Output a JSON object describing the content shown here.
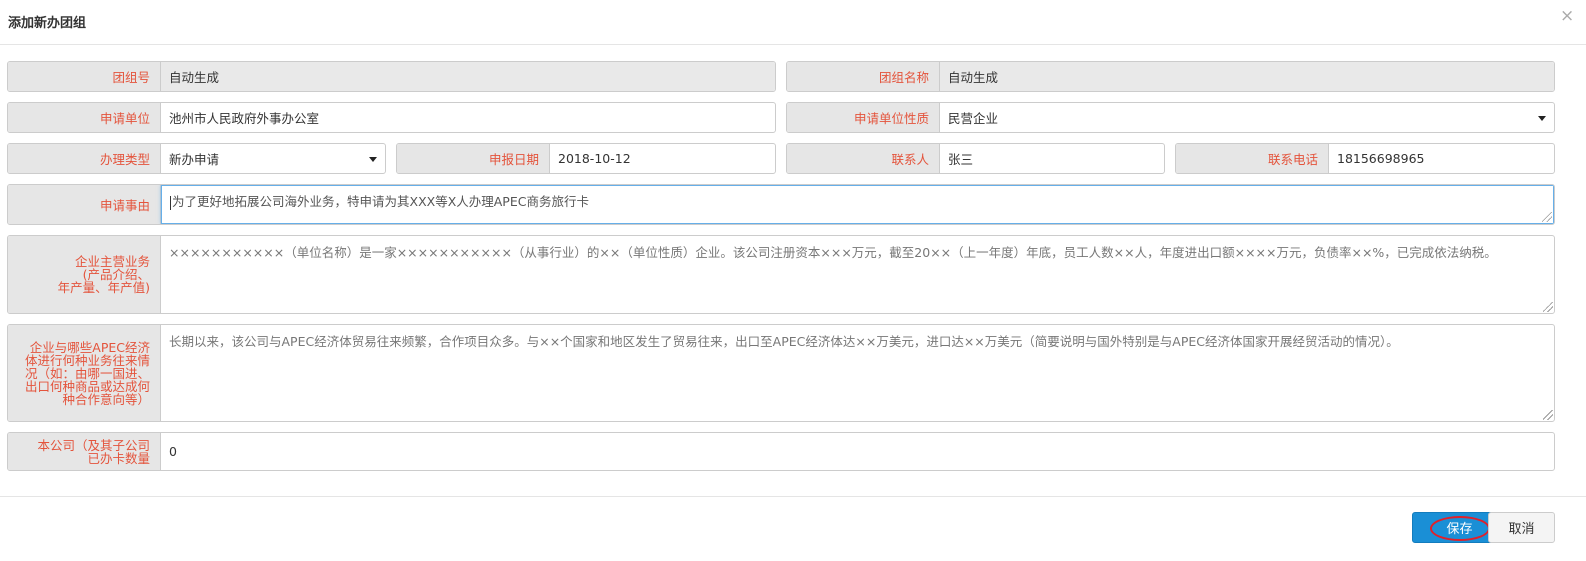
{
  "dialog": {
    "title": "添加新办团组",
    "close": "×"
  },
  "form": {
    "group_no": {
      "label": "团组号",
      "value": "自动生成"
    },
    "group_name": {
      "label": "团组名称",
      "value": "自动生成"
    },
    "applicant_unit": {
      "label": "申请单位",
      "value": "池州市人民政府外事办公室"
    },
    "unit_nature": {
      "label": "申请单位性质",
      "value": "民营企业"
    },
    "handle_type": {
      "label": "办理类型",
      "value": "新办申请"
    },
    "report_date": {
      "label": "申报日期",
      "value": "2018-10-12"
    },
    "contact": {
      "label": "联系人",
      "value": "张三"
    },
    "phone": {
      "label": "联系电话",
      "value": "18156698965"
    },
    "reason": {
      "label": "申请事由",
      "value": "为了更好地拓展公司海外业务，特申请为其XXX等X人办理APEC商务旅行卡"
    },
    "main_business": {
      "label_lines": [
        "企业主营业务",
        "(产品介绍、",
        "年产量、年产值)"
      ],
      "placeholder": "×××××××××××（单位名称）是一家×××××××××××（从事行业）的××（单位性质）企业。该公司注册资本×××万元，截至20××（上一年度）年底，员工人数××人，年度进出口额××××万元，负债率××%，已完成依法纳税。"
    },
    "apec_business": {
      "label_lines": [
        "企业与哪些APEC经济",
        "体进行何种业务往来情",
        "况（如：由哪一国进、",
        "出口何种商品或达成何",
        "种合作意向等）"
      ],
      "placeholder": "长期以来，该公司与APEC经济体贸易往来频繁，合作项目众多。与××个国家和地区发生了贸易往来，出口至APEC经济体达××万美元，进口达××万美元（简要说明与国外特别是与APEC经济体国家开展经贸活动的情况）。"
    },
    "card_count": {
      "label_lines": [
        "本公司（及其子公司",
        "已办卡数量"
      ],
      "value": "0"
    }
  },
  "buttons": {
    "save": "保存",
    "cancel": "取消"
  },
  "colors": {
    "label_text": "#e4543c",
    "label_bg": "#e6e6e6",
    "primary": "#1a8fd6",
    "highlight_ring": "#e0202a"
  }
}
